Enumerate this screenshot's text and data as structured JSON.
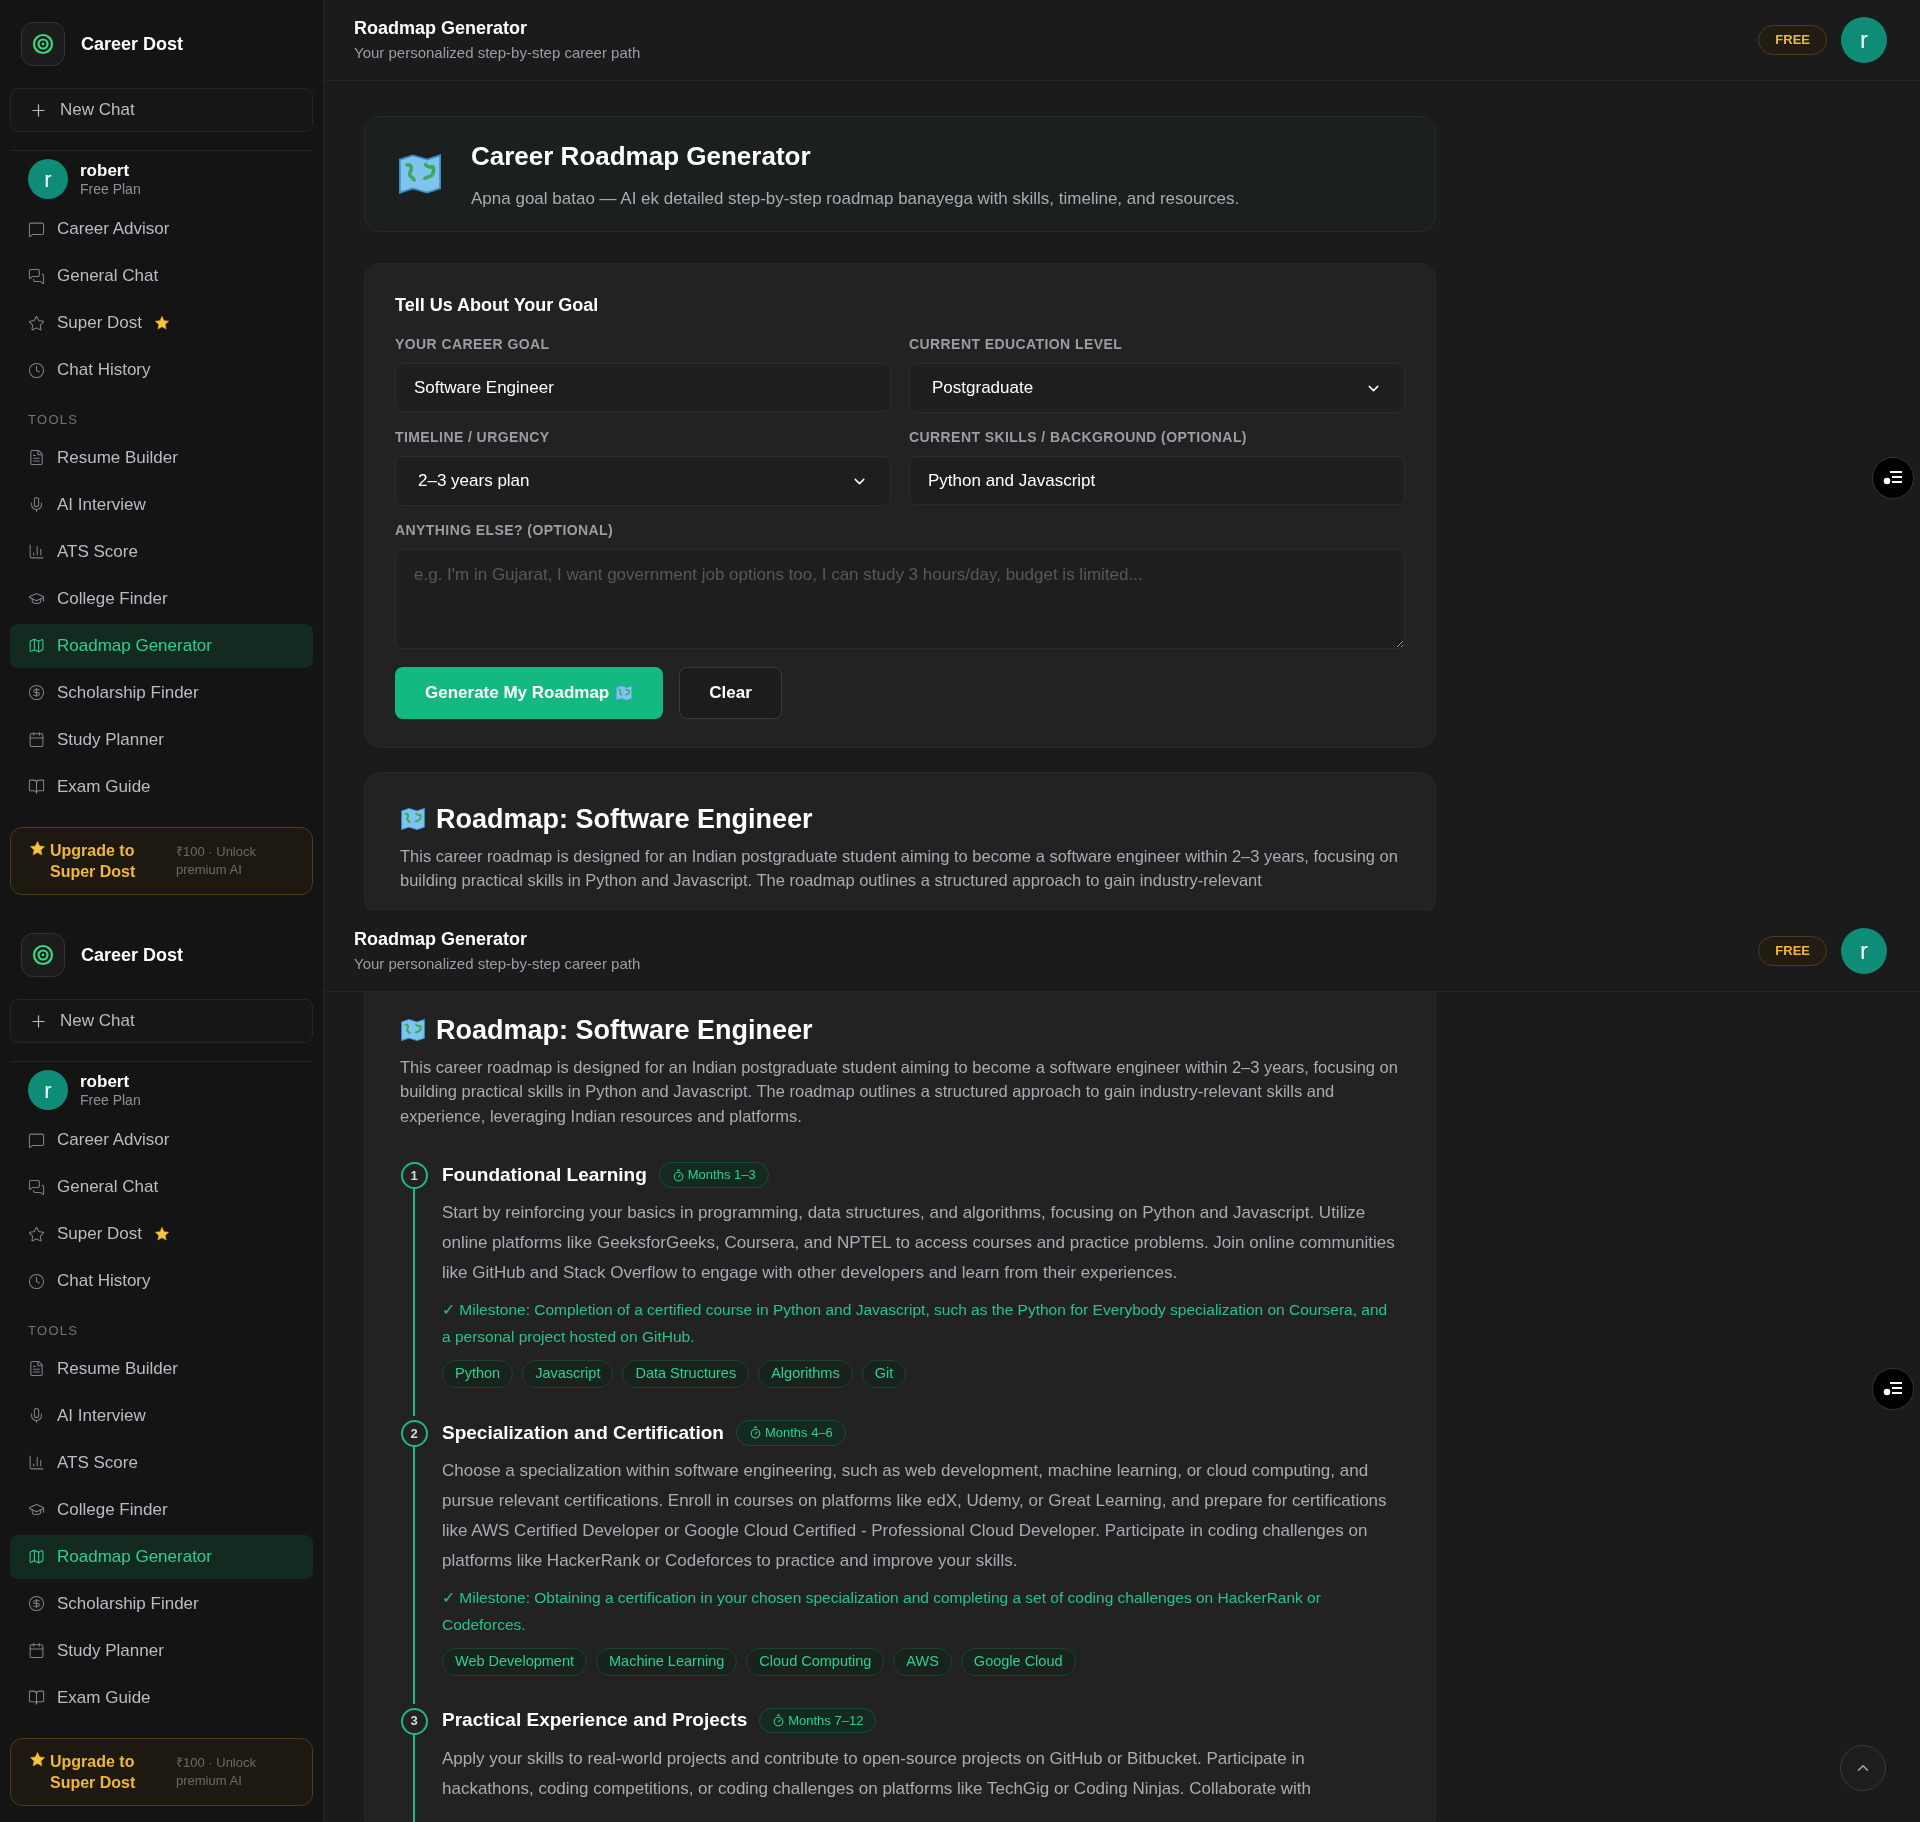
{
  "panes": [
    {
      "sidebar": {
        "brand": "Career Dost",
        "new_chat": "New Chat",
        "user": {
          "initial": "r",
          "name": "robert",
          "plan": "Free Plan"
        },
        "nav": [
          {
            "label": "Career Advisor",
            "selected": false
          },
          {
            "label": "General Chat",
            "selected": false
          },
          {
            "label": "Super Dost",
            "selected": false
          },
          {
            "label": "Chat History",
            "selected": false
          }
        ],
        "tools_label": "TOOLS",
        "tools": [
          {
            "label": "Resume Builder",
            "selected": false
          },
          {
            "label": "AI Interview",
            "selected": false
          },
          {
            "label": "ATS Score",
            "selected": false
          },
          {
            "label": "College Finder",
            "selected": false
          },
          {
            "label": "Roadmap Generator",
            "selected": true
          },
          {
            "label": "Scholarship Finder",
            "selected": false
          },
          {
            "label": "Study Planner",
            "selected": false
          },
          {
            "label": "Exam Guide",
            "selected": false
          }
        ],
        "upgrade": {
          "title": "Upgrade to Super Dost",
          "note": "₹100 · Unlock premium AI"
        }
      },
      "header": {
        "title": "Roadmap Generator",
        "subtitle": "Your personalized step-by-step career path",
        "plan_badge": "FREE",
        "avatar": "r"
      },
      "intro_card": {
        "title": "Career Roadmap Generator",
        "text": "Apna goal batao — AI ek detailed step-by-step roadmap banayega with skills, timeline, and resources."
      },
      "form": {
        "title": "Tell Us About Your Goal",
        "fields": [
          {
            "kind": "text",
            "label": "YOUR CAREER GOAL",
            "value": "Software Engineer"
          },
          {
            "kind": "select",
            "label": "CURRENT EDUCATION LEVEL",
            "value": "Postgraduate"
          },
          {
            "kind": "select",
            "label": "TIMELINE / URGENCY",
            "value": "2–3 years plan"
          },
          {
            "kind": "text",
            "label": "CURRENT SKILLS / BACKGROUND (OPTIONAL)",
            "value": "Python and Javascript"
          },
          {
            "kind": "textarea",
            "label": "ANYTHING ELSE? (OPTIONAL)",
            "placeholder": "e.g. I'm in Gujarat, I want government job options too, I can study 3 hours/day, budget is limited..."
          }
        ],
        "generate_button": "Generate My Roadmap",
        "clear_button": "Clear"
      },
      "roadmap": {
        "title": "Roadmap: Software Engineer",
        "summary": "This career roadmap is designed for an Indian postgraduate student aiming to become a software engineer within 2–3 years, focusing on building practical skills in Python and Javascript. The roadmap outlines a structured approach to gain industry-relevant"
      }
    },
    {
      "sidebar": {
        "brand": "Career Dost",
        "new_chat": "New Chat",
        "user": {
          "initial": "r",
          "name": "robert",
          "plan": "Free Plan"
        },
        "nav": [
          {
            "label": "Career Advisor",
            "selected": false
          },
          {
            "label": "General Chat",
            "selected": false
          },
          {
            "label": "Super Dost",
            "selected": false
          },
          {
            "label": "Chat History",
            "selected": false
          }
        ],
        "tools_label": "TOOLS",
        "tools": [
          {
            "label": "Resume Builder",
            "selected": false
          },
          {
            "label": "AI Interview",
            "selected": false
          },
          {
            "label": "ATS Score",
            "selected": false
          },
          {
            "label": "College Finder",
            "selected": false
          },
          {
            "label": "Roadmap Generator",
            "selected": true
          },
          {
            "label": "Scholarship Finder",
            "selected": false
          },
          {
            "label": "Study Planner",
            "selected": false
          },
          {
            "label": "Exam Guide",
            "selected": false
          }
        ],
        "upgrade": {
          "title": "Upgrade to Super Dost",
          "note": "₹100 · Unlock premium AI"
        }
      },
      "header": {
        "title": "Roadmap Generator",
        "subtitle": "Your personalized step-by-step career path",
        "plan_badge": "FREE",
        "avatar": "r"
      },
      "roadmap": {
        "title": "Roadmap: Software Engineer",
        "summary": "This career roadmap is designed for an Indian postgraduate student aiming to become a software engineer within 2–3 years, focusing on building practical skills in Python and Javascript. The roadmap outlines a structured approach to gain industry-relevant skills and experience, leveraging Indian resources and platforms.",
        "steps": [
          {
            "number": "1",
            "title": "Foundational Learning",
            "duration": "Months 1–3",
            "description": "Start by reinforcing your basics in programming, data structures, and algorithms, focusing on Python and Javascript. Utilize online platforms like GeeksforGeeks, Coursera, and NPTEL to access courses and practice problems. Join online communities like GitHub and Stack Overflow to engage with other developers and learn from their experiences.",
            "milestone": "✓ Milestone: Completion of a certified course in Python and Javascript, such as the Python for Everybody specialization on Coursera, and a personal project hosted on GitHub.",
            "skills": [
              "Python",
              "Javascript",
              "Data Structures",
              "Algorithms",
              "Git"
            ]
          },
          {
            "number": "2",
            "title": "Specialization and Certification",
            "duration": "Months 4–6",
            "description": "Choose a specialization within software engineering, such as web development, machine learning, or cloud computing, and pursue relevant certifications. Enroll in courses on platforms like edX, Udemy, or Great Learning, and prepare for certifications like AWS Certified Developer or Google Cloud Certified - Professional Cloud Developer. Participate in coding challenges on platforms like HackerRank or Codeforces to practice and improve your skills.",
            "milestone": "✓ Milestone: Obtaining a certification in your chosen specialization and completing a set of coding challenges on HackerRank or Codeforces.",
            "skills": [
              "Web Development",
              "Machine Learning",
              "Cloud Computing",
              "AWS",
              "Google Cloud"
            ]
          },
          {
            "number": "3",
            "title": "Practical Experience and Projects",
            "duration": "Months 7–12",
            "description": "Apply your skills to real-world projects and contribute to open-source projects on GitHub or Bitbucket. Participate in hackathons, coding competitions, or coding challenges on platforms like TechGig or Coding Ninjas. Collaborate with"
          }
        ]
      }
    }
  ]
}
